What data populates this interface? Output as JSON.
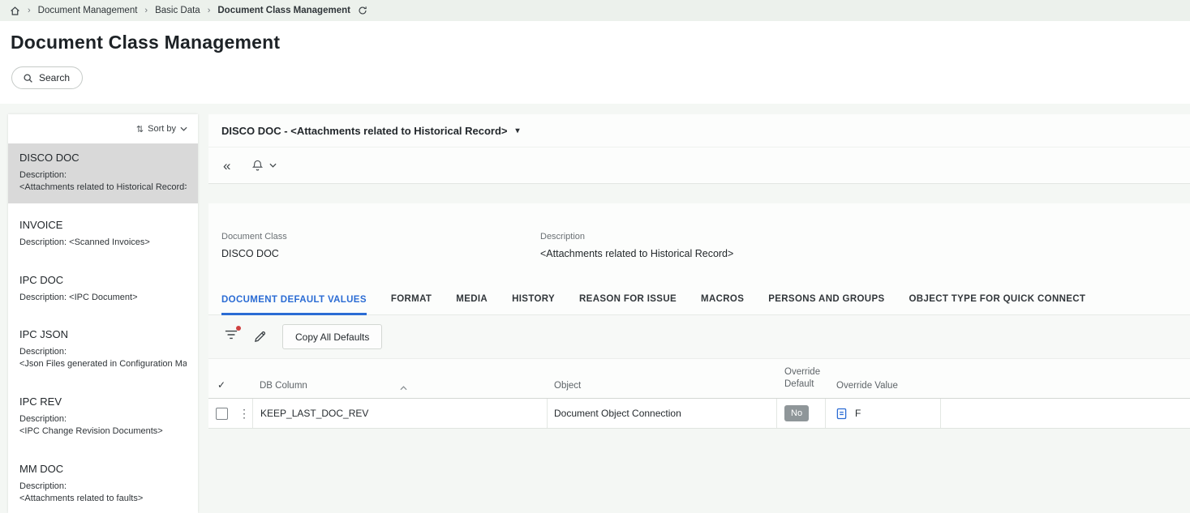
{
  "colors": {
    "accent_blue": "#2b6cd4",
    "badge_gray": "#8f9699",
    "alert_red": "#cf4040",
    "breadcrumb_bg": "#ecf1ec",
    "selected_item_bg": "#d9d9d9"
  },
  "icons": {
    "collapse": "«",
    "kebab": "⋮",
    "caret_down": "▾",
    "check": "✓",
    "sort_arrows": "⇅",
    "crumb_sep": "›"
  },
  "breadcrumb": {
    "items": [
      "Document Management",
      "Basic Data",
      "Document Class Management"
    ]
  },
  "header": {
    "title": "Document Class Management",
    "search_label": "Search"
  },
  "sidebar": {
    "sort_label": "Sort by",
    "description_label": "Description:",
    "items": [
      {
        "name": "DISCO DOC",
        "desc": "<Attachments related to Historical Record>"
      },
      {
        "name": "INVOICE",
        "desc": "<Scanned Invoices>"
      },
      {
        "name": "IPC DOC",
        "desc": "<IPC Document>"
      },
      {
        "name": "IPC JSON",
        "desc": "<Json Files generated in Configuration Mana"
      },
      {
        "name": "IPC REV",
        "desc": "<IPC Change Revision Documents>"
      },
      {
        "name": "MM DOC",
        "desc": "<Attachments related to faults>"
      }
    ]
  },
  "detail": {
    "selected_header": "DISCO DOC - <Attachments related to Historical Record>",
    "fields": [
      {
        "label": "Document Class",
        "value": "DISCO DOC"
      },
      {
        "label": "Description",
        "value": "<Attachments related to Historical Record>"
      }
    ],
    "tabs": [
      "DOCUMENT DEFAULT VALUES",
      "FORMAT",
      "MEDIA",
      "HISTORY",
      "REASON FOR ISSUE",
      "MACROS",
      "PERSONS AND GROUPS",
      "OBJECT TYPE FOR QUICK CONNECT"
    ],
    "toolbar": {
      "copy_button": "Copy All Defaults"
    },
    "table": {
      "columns": {
        "db": "DB Column",
        "object": "Object",
        "override_default": "Override Default",
        "override_value": "Override Value"
      },
      "rows": [
        {
          "db": "KEEP_LAST_DOC_REV",
          "object": "Document Object Connection",
          "override_default": "No",
          "override_value": "F"
        }
      ]
    }
  }
}
